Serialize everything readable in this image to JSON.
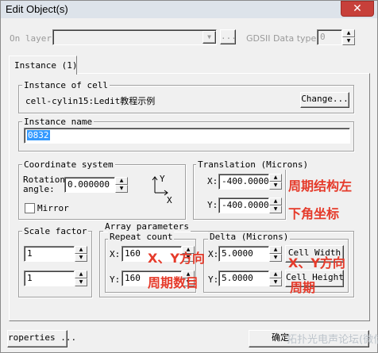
{
  "window": {
    "title": "Edit Object(s)",
    "close_glyph": "✕"
  },
  "top": {
    "on_layer_label": "On layer:",
    "on_layer_value": "",
    "ellipsis_label": "...",
    "gdsii_label": "GDSII Data type:",
    "gdsii_value": "0"
  },
  "tab": {
    "label": "Instance (1)"
  },
  "instance_of_cell": {
    "title": "Instance of cell",
    "value": "cell-cylin15:Ledit教程示例",
    "change_label": "Change..."
  },
  "instance_name": {
    "title": "Instance name",
    "value": "0832"
  },
  "coordinate_system": {
    "title": "Coordinate system",
    "rotation_label_1": "Rotation",
    "rotation_label_2": "angle:",
    "rotation_value": "0.000000",
    "mirror_label": "Mirror",
    "mirror_checked": false,
    "axis_y": "Y",
    "axis_x": "X"
  },
  "translation": {
    "title": "Translation (Microns)",
    "x_label": "X:",
    "x_value": "-400.0000",
    "y_label": "Y:",
    "y_value": "-400.0000"
  },
  "scale_factor": {
    "title": "Scale factor",
    "value_1": "1",
    "value_2": "1"
  },
  "array_parameters": {
    "title": "Array parameters",
    "repeat_count": {
      "title": "Repeat count",
      "x_label": "X:",
      "x_value": "160",
      "y_label": "Y:",
      "y_value": "160"
    },
    "delta": {
      "title": "Delta (Microns)",
      "x_label": "X:",
      "x_value": "5.0000",
      "y_label": "Y:",
      "y_value": "5.0000",
      "cell_width_label": "Cell Width",
      "cell_height_label": "Cell Height"
    }
  },
  "annotations": {
    "translation_1": "周期结构左",
    "translation_2": "下角坐标",
    "repeat_1": "X、Y方向",
    "repeat_2": "周期数目",
    "delta_1": "X、Y方向",
    "delta_2": "周期",
    "color": "#e53a2a"
  },
  "bottom": {
    "properties_label": "roperties ...",
    "right_button_label": "确定",
    "watermark": "拓扑光电声论坛(微信)"
  }
}
